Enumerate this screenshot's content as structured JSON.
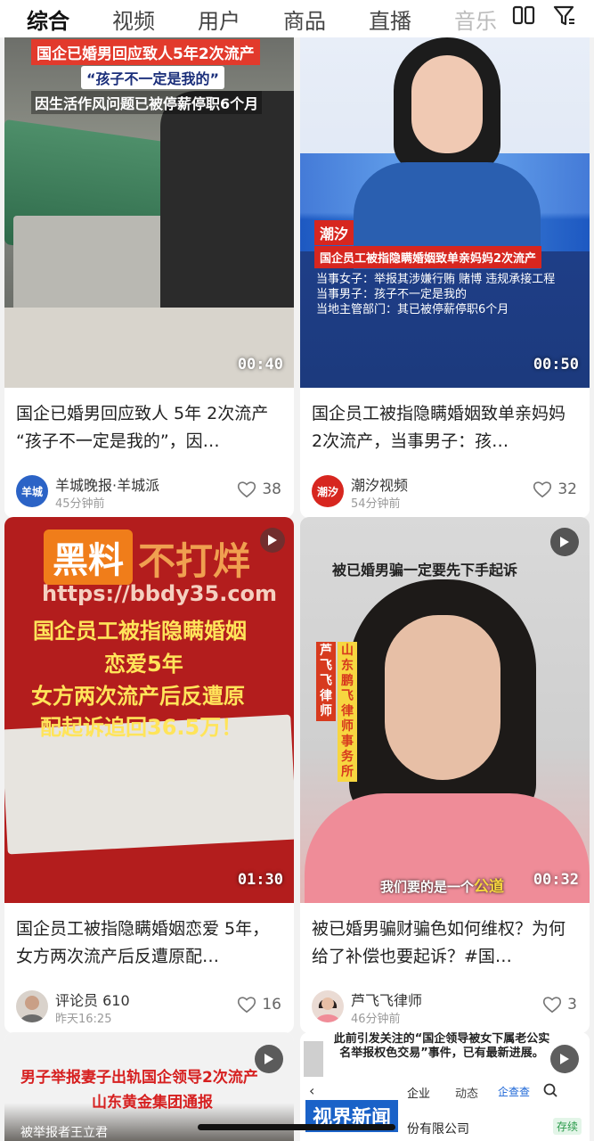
{
  "nav": {
    "tabs": [
      "综合",
      "视频",
      "用户",
      "商品",
      "直播",
      "音乐"
    ],
    "active_tab": "综合",
    "layout_icon": "grid-layout-icon",
    "filter_icon": "filter-icon"
  },
  "cards": [
    {
      "duration": "00:40",
      "title": "国企已婚男回应致人 5年 2次流产 “孩子不一定是我的”，因…",
      "author": "羊城晚报·羊城派",
      "time": "45分钟前",
      "likes": "38",
      "avatar_text": "羊城",
      "overlay": {
        "line1": "国企已婚男回应致人5年2次流产",
        "line2": "“孩子不一定是我的”",
        "line3": "因生活作风问题已被停薪停职6个月"
      }
    },
    {
      "duration": "00:50",
      "title": "国企员工被指隐瞒婚姻致单亲妈妈 2次流产，当事男子：孩…",
      "author": "潮汐视频",
      "time": "54分钟前",
      "likes": "32",
      "avatar_text": "潮汐",
      "overlay": {
        "logo": "潮汐",
        "banner": "国企员工被指隐瞒婚姻致单亲妈妈2次流产",
        "line1": "当事女子：举报其涉嫌行贿 赌博 违规承接工程",
        "line2": "当事男子：孩子不一定是我的",
        "line3": "当地主管部门：其已被停薪停职6个月"
      }
    },
    {
      "duration": "01:30",
      "title": "国企员工被指隐瞒婚姻恋爱 5年，女方两次流产后反遭原配…",
      "author": "评论员 610",
      "time": "昨天16:25",
      "likes": "16",
      "overlay": {
        "watermark1": "黑料",
        "watermark2": "不打烊",
        "watermark_url": "https://bbdy35.com",
        "line1": "国企员工被指隐瞒婚姻",
        "line2": "恋爱5年",
        "line3": "女方两次流产后反遭原",
        "line4": "配起诉追回36.5万！"
      }
    },
    {
      "duration": "00:32",
      "title": "被已婚男骗财骗色如何维权？为何给了补偿也要起诉？#国…",
      "author": "芦飞飞律师",
      "time": "46分钟前",
      "likes": "3",
      "overlay": {
        "top": "被已婚男骗一定要先下手起诉",
        "side1": "山东鹏飞律师事务所",
        "side2": "芦飞飞律师",
        "subtitle_prefix": "我们要的是一个",
        "subtitle_highlight": "公道"
      }
    },
    {
      "overlay": {
        "line1": "男子举报妻子出轨国企领导2次流产",
        "line2": "山东黄金集团通报",
        "line3": "被举报者王立君"
      }
    },
    {
      "overlay": {
        "headline": "此前引发关注的“国企领导被女下属老公实名举报权色交易”事件，已有最新进展。",
        "tab1": "企业",
        "tab2": "动态",
        "tab3": "企查查",
        "company": "份有限公司",
        "badge": "存续",
        "logo": "视界新闻"
      }
    }
  ]
}
